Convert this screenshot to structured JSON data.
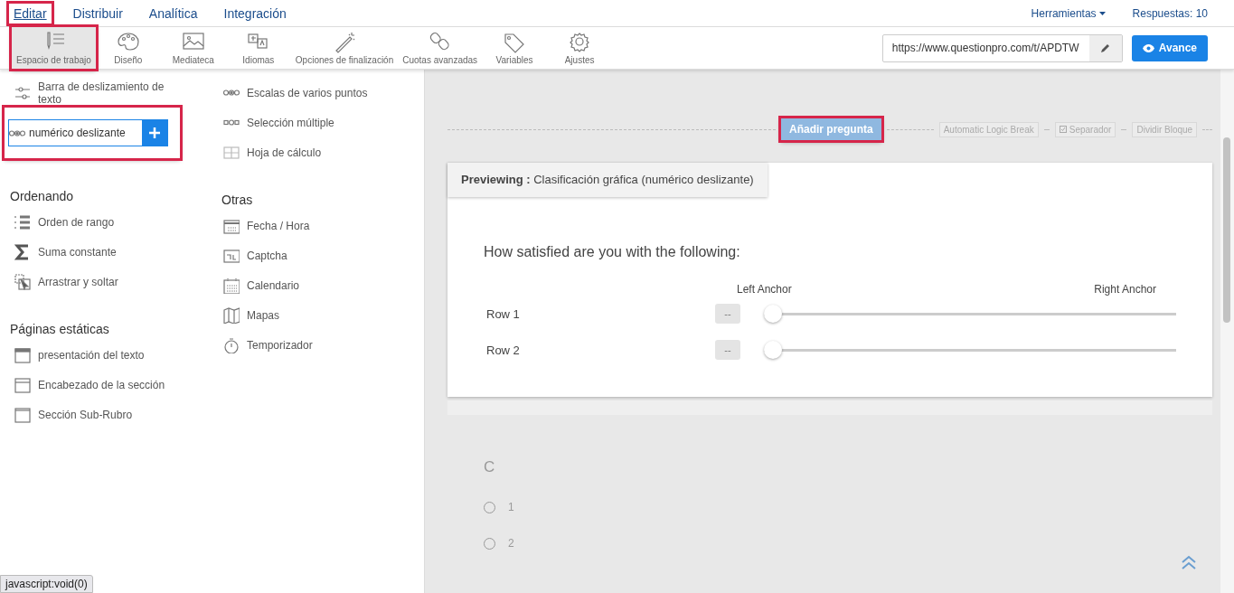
{
  "top_nav": {
    "tabs": [
      {
        "label": "Editar",
        "selected": true,
        "highlighted": true
      },
      {
        "label": "Distribuir",
        "selected": false,
        "highlighted": false
      },
      {
        "label": "Analítica",
        "selected": false,
        "highlighted": false
      },
      {
        "label": "Integración",
        "selected": false,
        "highlighted": false
      }
    ],
    "tools_menu": "Herramientas",
    "responses": "Respuestas: 10"
  },
  "toolbar": {
    "items": [
      {
        "label": "Espacio de trabajo",
        "selected": true,
        "highlighted": true
      },
      {
        "label": "Diseño",
        "selected": false,
        "highlighted": false
      },
      {
        "label": "Mediateca",
        "selected": false,
        "highlighted": false
      },
      {
        "label": "Idiomas",
        "selected": false,
        "highlighted": false
      },
      {
        "label": "Opciones de finalización",
        "selected": false,
        "highlighted": false
      },
      {
        "label": "Cuotas avanzadas",
        "selected": false,
        "highlighted": false
      },
      {
        "label": "Variables",
        "selected": false,
        "highlighted": false
      },
      {
        "label": "Ajustes",
        "selected": false,
        "highlighted": false
      }
    ],
    "url": "https://www.questionpro.com/t/APDTW",
    "preview_button": "Avance"
  },
  "sidebar": {
    "columns": [
      {
        "groups": [
          {
            "items": [
              {
                "label": "Barra de deslizamiento de texto",
                "kind": "plain",
                "highlighted": false
              },
              {
                "label": "numérico deslizante",
                "kind": "add",
                "highlighted": true
              }
            ]
          },
          {
            "heading": "Ordenando",
            "items": [
              {
                "label": "Orden de rango",
                "kind": "plain",
                "highlighted": false
              },
              {
                "label": "Suma constante",
                "kind": "plain",
                "highlighted": false
              },
              {
                "label": "Arrastrar y soltar",
                "kind": "plain",
                "highlighted": false
              }
            ]
          },
          {
            "heading": "Páginas estáticas",
            "items": [
              {
                "label": "presentación del texto",
                "kind": "plain",
                "highlighted": false
              },
              {
                "label": "Encabezado de la sección",
                "kind": "plain",
                "highlighted": false
              },
              {
                "label": "Sección Sub-Rubro",
                "kind": "plain",
                "highlighted": false
              }
            ]
          }
        ]
      },
      {
        "groups": [
          {
            "items": [
              {
                "label": "Escalas de varios puntos",
                "kind": "plain",
                "highlighted": false
              },
              {
                "label": "Selección múltiple",
                "kind": "plain",
                "highlighted": false
              },
              {
                "label": "Hoja de cálculo",
                "kind": "plain",
                "highlighted": false
              }
            ]
          },
          {
            "heading": "Otras",
            "items": [
              {
                "label": "Fecha / Hora",
                "kind": "plain",
                "highlighted": false
              },
              {
                "label": "Captcha",
                "kind": "plain",
                "highlighted": false
              },
              {
                "label": "Calendario",
                "kind": "plain",
                "highlighted": false
              },
              {
                "label": "Mapas",
                "kind": "plain",
                "highlighted": false
              },
              {
                "label": "Temporizador",
                "kind": "plain",
                "highlighted": false
              }
            ]
          }
        ]
      }
    ]
  },
  "insert_bar": {
    "add_button": "Añadir pregunta",
    "highlighted": true,
    "actions": [
      "Automatic Logic Break",
      "Separador",
      "Dividir Bloque"
    ]
  },
  "preview": {
    "label": "Previewing :",
    "title": "Clasificación gráfica (numérico deslizante)",
    "question": "How satisfied are you with the following:",
    "anchors": [
      "Left Anchor",
      "Right Anchor"
    ],
    "rows": [
      {
        "label": "Row 1",
        "value": "--",
        "level": 0
      },
      {
        "label": "Row 2",
        "value": "--",
        "level": 0
      }
    ]
  },
  "next_question": {
    "title": "C",
    "options": [
      {
        "label": "1",
        "selected": false
      },
      {
        "label": "2",
        "selected": false
      }
    ]
  },
  "status_bar": "javascript:void(0)"
}
